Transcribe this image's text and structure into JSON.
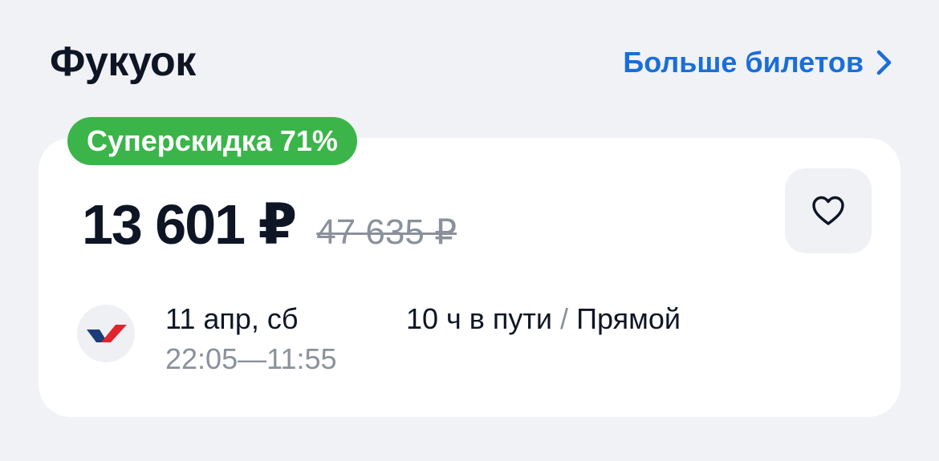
{
  "header": {
    "title": "Фукуок",
    "more_link": "Больше билетов"
  },
  "offer": {
    "badge": "Суперскидка 71%",
    "price": "13 601 ₽",
    "old_price": "47 635 ₽",
    "date": "11 апр, сб",
    "departure_time": "22:05",
    "time_separator": "—",
    "arrival_time": "11:55",
    "duration": "10 ч в пути",
    "route_separator": "/",
    "stops": "Прямой"
  },
  "colors": {
    "accent_link": "#1a6ed8",
    "badge_green": "#3bb54a",
    "muted_text": "#8a919c"
  },
  "icons": {
    "more": "chevron-right-icon",
    "favorite": "heart-icon",
    "airline": "airline-logo-icon"
  }
}
